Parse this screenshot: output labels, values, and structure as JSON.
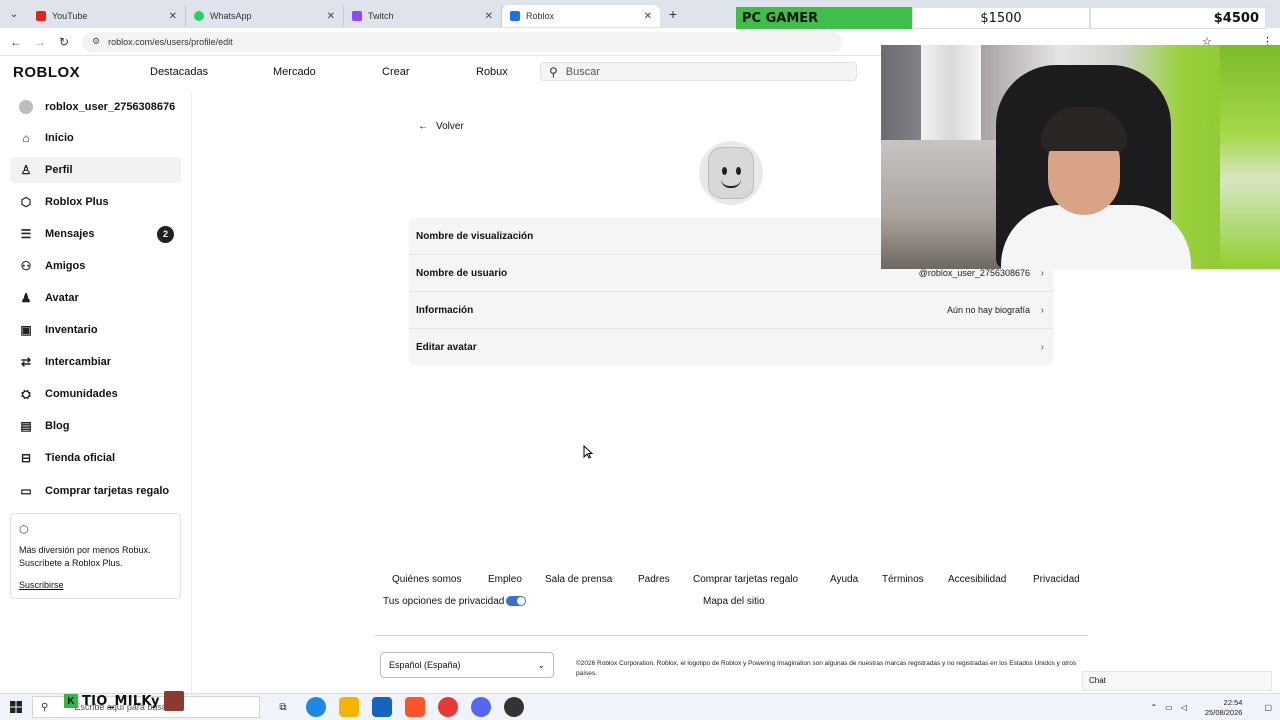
{
  "browser": {
    "tabs": [
      {
        "title": "YouTube",
        "color": "#e62117"
      },
      {
        "title": "WhatsApp",
        "color": "#25d366"
      },
      {
        "title": "Twitch",
        "color": "#9146ff"
      },
      {
        "title": "Roblox",
        "color": "#1a73e8",
        "active": true
      }
    ],
    "url": "roblox.com/es/users/profile/edit"
  },
  "overlay": {
    "pc_gamer": "PC GAMER",
    "current": "$1500",
    "goal": "$4500"
  },
  "header": {
    "logo": "ROBLOX",
    "nav": [
      "Destacadas",
      "Mercado",
      "Crear",
      "Robux"
    ],
    "search_placeholder": "Buscar"
  },
  "sidebar": {
    "items": [
      {
        "label": "roblox_user_2756308676",
        "icon": "avatar-icon"
      },
      {
        "label": "Inicio",
        "icon": "home-icon"
      },
      {
        "label": "Perfil",
        "icon": "profile-icon",
        "active": true
      },
      {
        "label": "Roblox Plus",
        "icon": "roblox-plus-icon"
      },
      {
        "label": "Mensajes",
        "icon": "messages-icon",
        "badge": "2"
      },
      {
        "label": "Amigos",
        "icon": "friends-icon"
      },
      {
        "label": "Avatar",
        "icon": "avatar-figure-icon"
      },
      {
        "label": "Inventario",
        "icon": "inventory-icon"
      },
      {
        "label": "Intercambiar",
        "icon": "trade-icon"
      },
      {
        "label": "Comunidades",
        "icon": "communities-icon"
      },
      {
        "label": "Blog",
        "icon": "blog-icon"
      },
      {
        "label": "Tienda oficial",
        "icon": "store-icon"
      },
      {
        "label": "Comprar tarjetas regalo",
        "icon": "gift-card-icon"
      }
    ],
    "promo": {
      "text": "Más diversión por menos Robux. Suscríbete a Roblox Plus.",
      "link": "Suscribirse"
    }
  },
  "main": {
    "back_label": "Volver",
    "rows": [
      {
        "label": "Nombre de visualización",
        "value": ""
      },
      {
        "label": "Nombre de usuario",
        "value": "@roblox_user_2756308676"
      },
      {
        "label": "Información",
        "value": "Aún no hay biografía"
      },
      {
        "label": "Editar avatar",
        "value": ""
      }
    ]
  },
  "footer": {
    "links": [
      "Quiénes somos",
      "Empleo",
      "Sala de prensa",
      "Padres",
      "Comprar tarjetas regalo",
      "Ayuda",
      "Términos",
      "Accesibilidad",
      "Privacidad"
    ],
    "privacy_options": "Tus opciones de privacidad",
    "sitemap": "Mapa del sitio",
    "language": "Español (España)",
    "copyright": "©2026 Roblox Corporation. Roblox, el logotipo de Roblox y Powering Imagination son algunas de nuestras marcas registradas y no registradas en los Estados Unidos y otros países."
  },
  "taskbar": {
    "search_placeholder": "Escribe aquí para buscar",
    "streamer": "TIO_MILKy",
    "time": "22:54",
    "date": "25/08/2026",
    "chat": "Chat"
  }
}
